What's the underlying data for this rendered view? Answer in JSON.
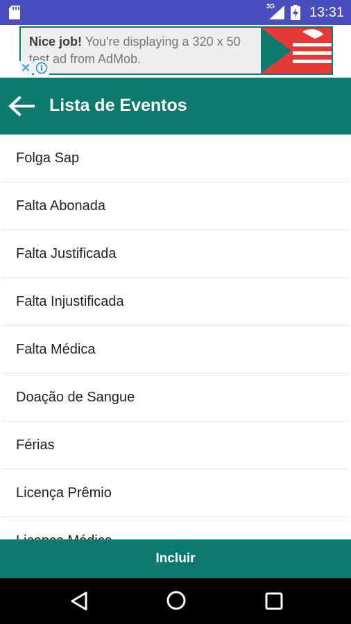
{
  "status_bar": {
    "network": "3G",
    "time": "13:31",
    "icons": [
      "sd-card-icon",
      "signal-icon",
      "battery-charging-icon"
    ]
  },
  "ad": {
    "headline": "Nice job!",
    "body": " You're displaying a 320 x 50 test ad from AdMob.",
    "close_glyph": "✕",
    "accent": "#0d7a6e"
  },
  "toolbar": {
    "title": "Lista de Eventos",
    "background": "#0d7a6e"
  },
  "events": [
    {
      "label": "Folga Sap"
    },
    {
      "label": "Falta Abonada"
    },
    {
      "label": "Falta Justificada"
    },
    {
      "label": "Falta Injustificada"
    },
    {
      "label": "Falta Médica"
    },
    {
      "label": "Doação de Sangue"
    },
    {
      "label": "Férias"
    },
    {
      "label": "Licença Prêmio"
    },
    {
      "label": "Licença Médica"
    }
  ],
  "actions": {
    "include_label": "Incluir"
  },
  "nav_bar": {
    "icons": [
      "back-triangle-icon",
      "home-circle-icon",
      "recents-square-icon"
    ]
  }
}
